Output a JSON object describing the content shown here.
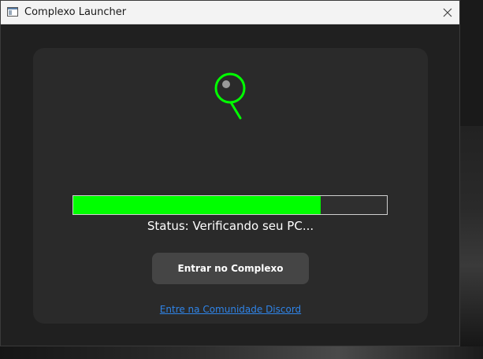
{
  "window": {
    "title": "Complexo Launcher"
  },
  "logo": {
    "icon": "magnifier-icon",
    "color": "#00ff00"
  },
  "progress": {
    "value_percent": 79,
    "fill_color": "#00ff00"
  },
  "status": {
    "text": "Status: Verificando seu PC..."
  },
  "actions": {
    "enter_label": "Entrar no Complexo",
    "discord_link": "Entre na Comunidade Discord"
  },
  "colors": {
    "accent": "#00ff00",
    "link": "#2f84e8",
    "card": "#2a2a2a",
    "window": "#202020"
  }
}
